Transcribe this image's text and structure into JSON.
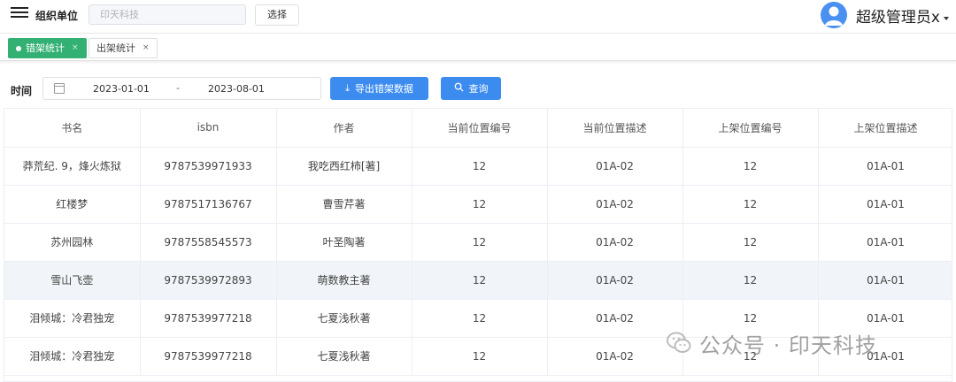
{
  "header": {
    "org_label": "组织单位",
    "org_input_value": "印天科技",
    "select_button": "选择",
    "username": "超级管理员x",
    "avatar_color": "#4a90f0"
  },
  "tabs": [
    {
      "label": "错架统计",
      "active": true,
      "close": "×"
    },
    {
      "label": "出架统计",
      "active": false,
      "close": "×"
    }
  ],
  "filter": {
    "time_label": "时间",
    "start_date": "2023-01-01",
    "separator": "-",
    "end_date": "2023-08-01",
    "export_button": "导出错架数据",
    "query_button": "查询"
  },
  "table": {
    "columns": [
      "书名",
      "isbn",
      "作者",
      "当前位置编号",
      "当前位置描述",
      "上架位置编号",
      "上架位置描述"
    ],
    "rows": [
      [
        "莽荒纪. 9，烽火炼狱",
        "9787539971933",
        "我吃西红柿[著]",
        "12",
        "01A-02",
        "12",
        "01A-01"
      ],
      [
        "红楼梦",
        "9787517136767",
        "曹雪芹著",
        "12",
        "01A-02",
        "12",
        "01A-01"
      ],
      [
        "苏州园林",
        "9787558545573",
        "叶圣陶著",
        "12",
        "01A-02",
        "12",
        "01A-01"
      ],
      [
        "雪山飞壶",
        "9787539972893",
        "萌数教主著",
        "12",
        "01A-02",
        "12",
        "01A-01"
      ],
      [
        "泪倾城：冷君独宠",
        "9787539977218",
        "七夏浅秋著",
        "12",
        "01A-02",
        "12",
        "01A-01"
      ],
      [
        "泪倾城：冷君独宠",
        "9787539977218",
        "七夏浅秋著",
        "12",
        "01A-02",
        "12",
        "01A-01"
      ]
    ]
  },
  "watermark": {
    "text": "公众号 · 印天科技"
  },
  "colors": {
    "active_tab": "#33b073",
    "primary_button": "#3c8cf0"
  }
}
